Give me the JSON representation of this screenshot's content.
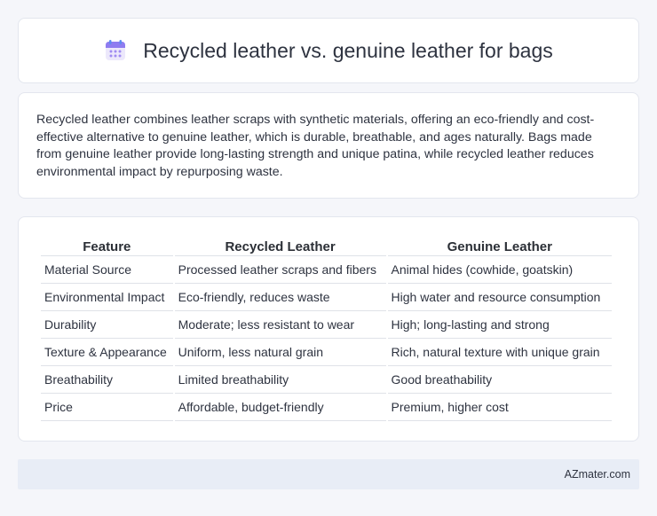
{
  "header": {
    "icon": "calendar-icon",
    "title": "Recycled leather vs. genuine leather for bags"
  },
  "intro": {
    "text": "Recycled leather combines leather scraps with synthetic materials, offering an eco-friendly and cost-effective alternative to genuine leather, which is durable, breathable, and ages naturally. Bags made from genuine leather provide long-lasting strength and unique patina, while recycled leather reduces environmental impact by repurposing waste."
  },
  "table": {
    "headers": [
      "Feature",
      "Recycled Leather",
      "Genuine Leather"
    ],
    "rows": [
      [
        "Material Source",
        "Processed leather scraps and fibers",
        "Animal hides (cowhide, goatskin)"
      ],
      [
        "Environmental Impact",
        "Eco-friendly, reduces waste",
        "High water and resource consumption"
      ],
      [
        "Durability",
        "Moderate; less resistant to wear",
        "High; long-lasting and strong"
      ],
      [
        "Texture & Appearance",
        "Uniform, less natural grain",
        "Rich, natural texture with unique grain"
      ],
      [
        "Breathability",
        "Limited breathability",
        "Good breathability"
      ],
      [
        "Price",
        "Affordable, budget-friendly",
        "Premium, higher cost"
      ]
    ]
  },
  "footer": {
    "brand": "AZmater.com"
  }
}
